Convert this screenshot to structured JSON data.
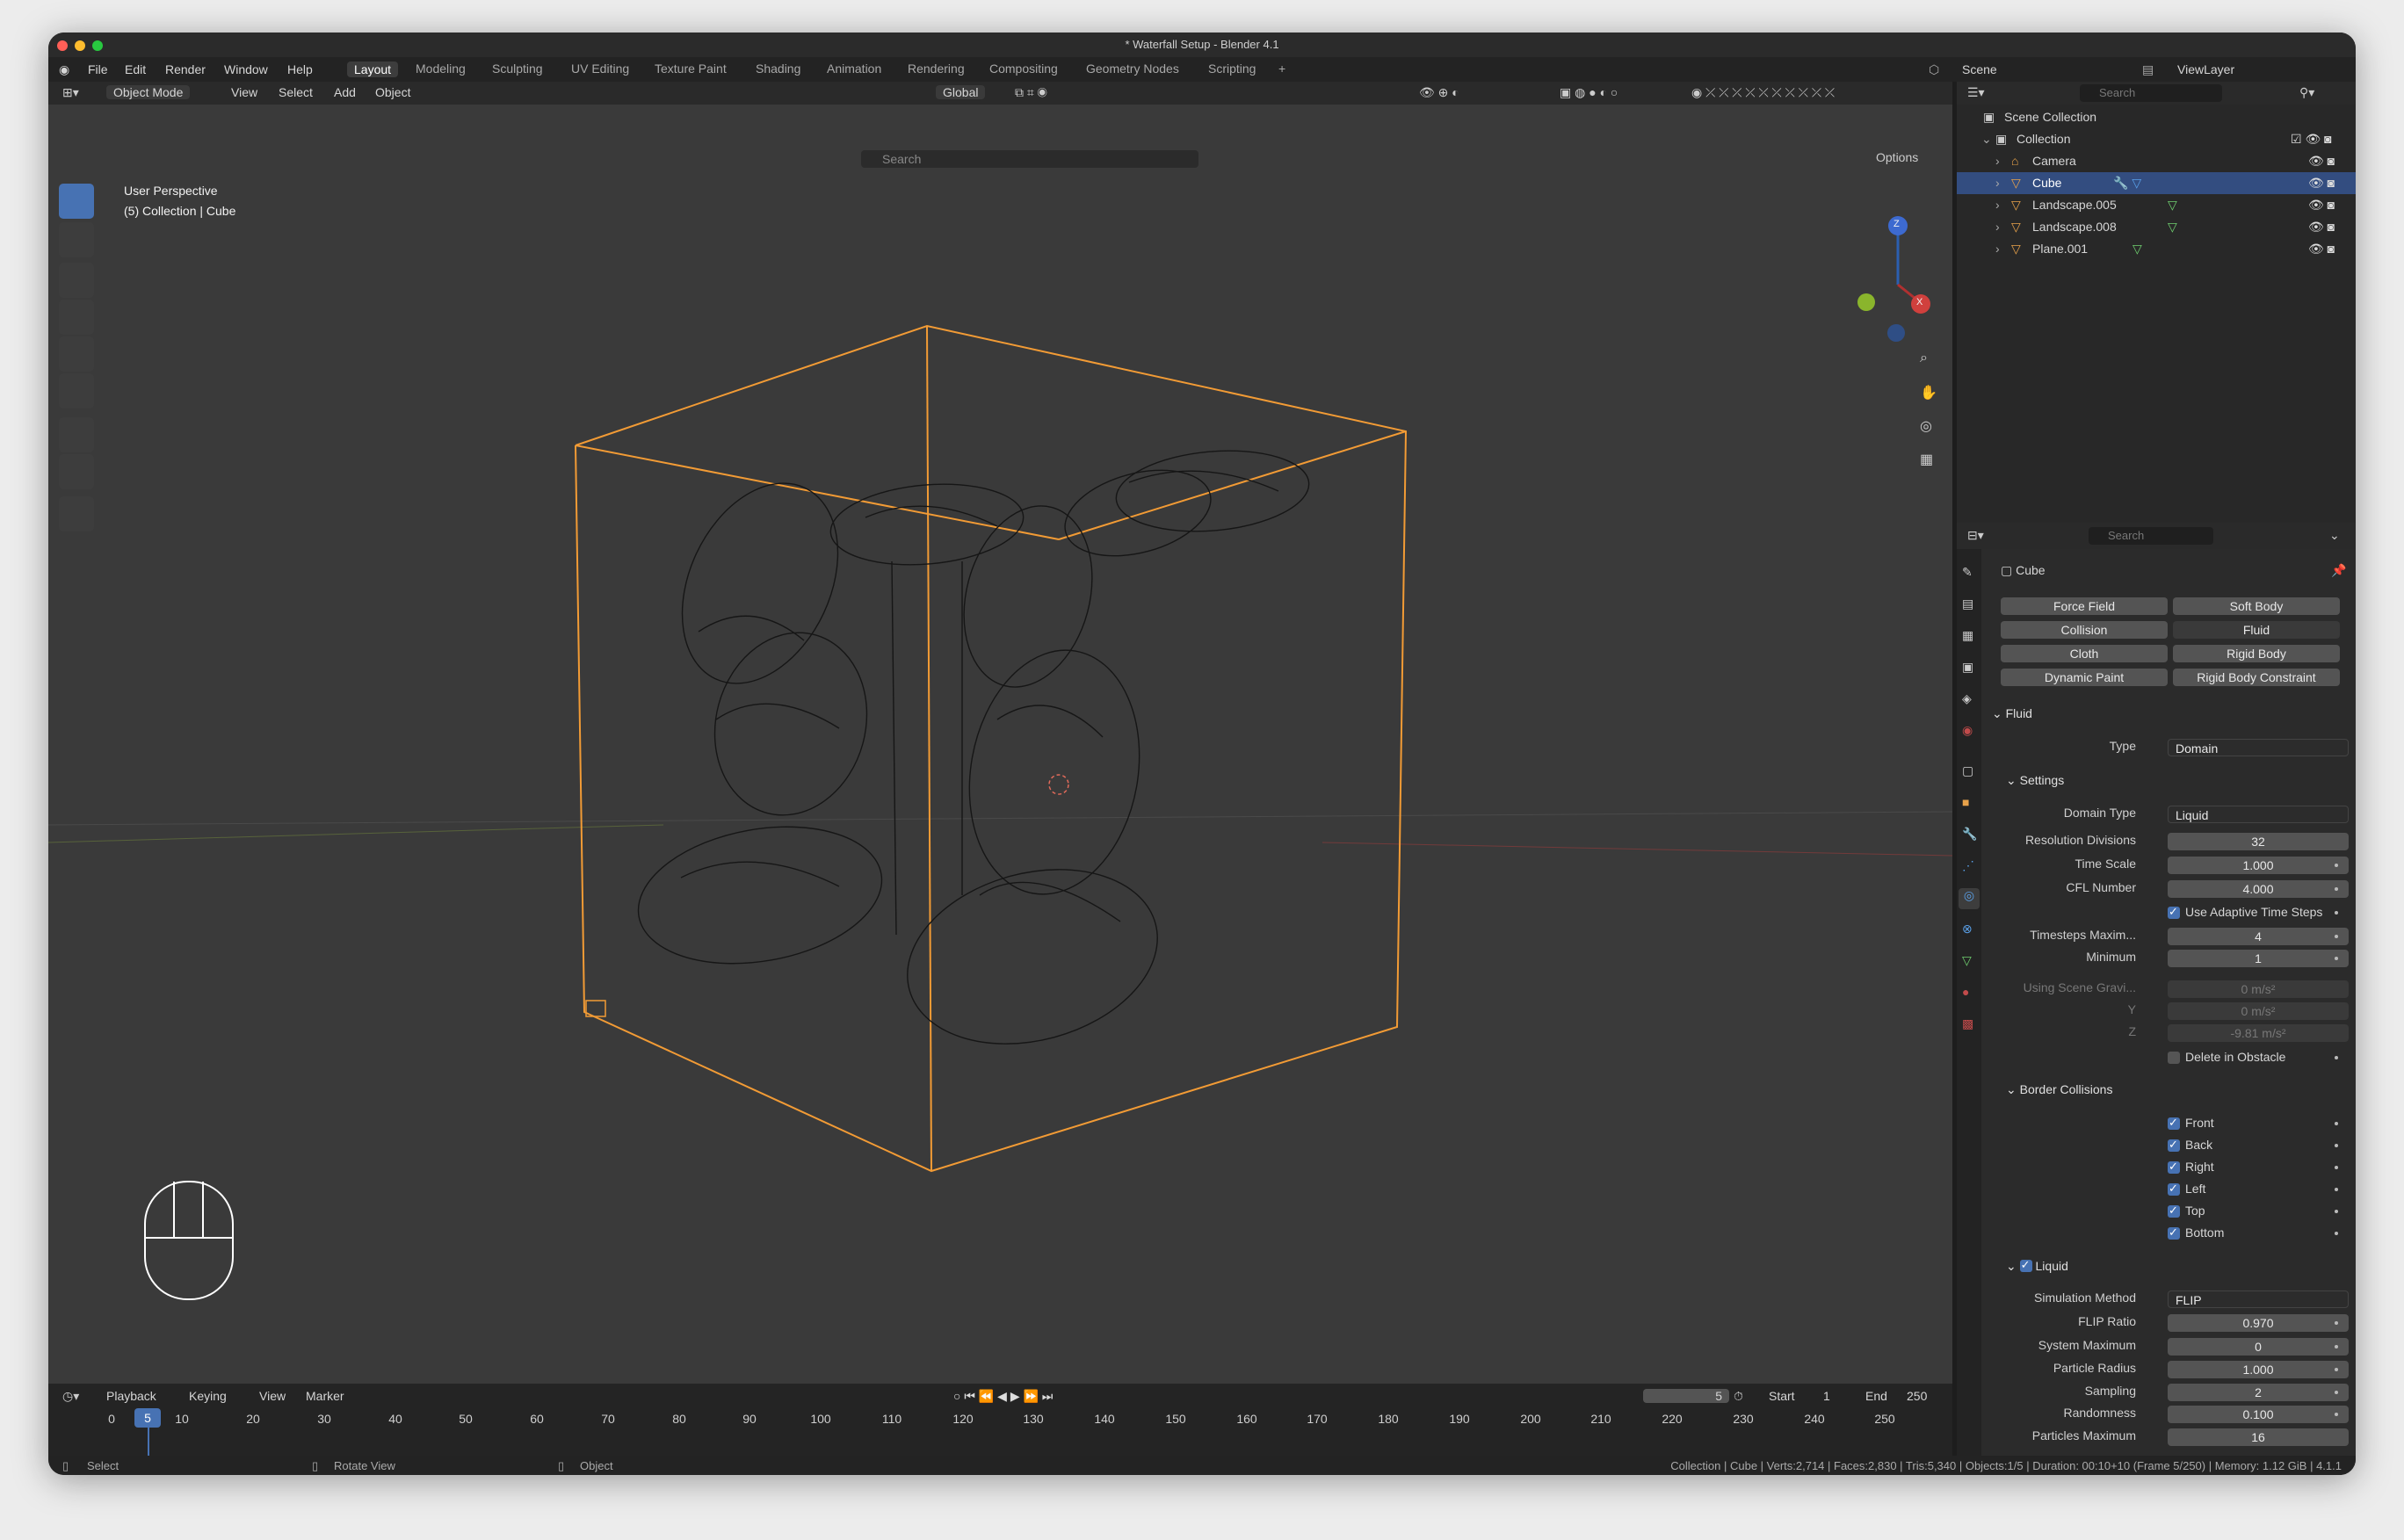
{
  "window_title": "* Waterfall Setup - Blender 4.1",
  "menu": [
    "File",
    "Edit",
    "Render",
    "Window",
    "Help"
  ],
  "workspaces": [
    "Layout",
    "Modeling",
    "Sculpting",
    "UV Editing",
    "Texture Paint",
    "Shading",
    "Animation",
    "Rendering",
    "Compositing",
    "Geometry Nodes",
    "Scripting",
    "+"
  ],
  "active_workspace": "Layout",
  "scene_label": "Scene",
  "viewlayer_label": "ViewLayer",
  "header": {
    "mode": "Object Mode",
    "view": "View",
    "select": "Select",
    "add": "Add",
    "object": "Object",
    "transform": "Global",
    "search_placeholder": "Search",
    "options": "Options"
  },
  "viewport": {
    "perspective": "User Perspective",
    "context": "(5) Collection | Cube"
  },
  "gizmo": {
    "z": "Z",
    "x": "X"
  },
  "outliner": {
    "search_placeholder": "Search",
    "scene_collection": "Scene Collection",
    "collection": "Collection",
    "items": [
      "Camera",
      "Cube",
      "Landscape.005",
      "Landscape.008",
      "Plane.001"
    ]
  },
  "properties": {
    "search_placeholder": "Search",
    "object_name": "Cube",
    "physics_buttons": [
      "Force Field",
      "Soft Body",
      "Collision",
      "Fluid",
      "Cloth",
      "Rigid Body",
      "Dynamic Paint",
      "Rigid Body Constraint"
    ],
    "fluid_section": "Fluid",
    "type_label": "Type",
    "type_value": "Domain",
    "settings_section": "Settings",
    "domain_type_label": "Domain Type",
    "domain_type_value": "Liquid",
    "res_label": "Resolution Divisions",
    "res_value": "32",
    "time_scale_label": "Time Scale",
    "time_scale_value": "1.000",
    "cfl_label": "CFL Number",
    "cfl_value": "4.000",
    "adaptive_label": "Use Adaptive Time Steps",
    "ts_max_label": "Timesteps Maxim...",
    "ts_max_value": "4",
    "ts_min_label": "Minimum",
    "ts_min_value": "1",
    "gravity_label": "Using Scene Gravi...",
    "gravity_x": "0 m/s²",
    "gravity_y_label": "Y",
    "gravity_y": "0 m/s²",
    "gravity_z_label": "Z",
    "gravity_z": "-9.81 m/s²",
    "delete_obstacle_label": "Delete in Obstacle",
    "border_section": "Border Collisions",
    "borders": [
      "Front",
      "Back",
      "Right",
      "Left",
      "Top",
      "Bottom"
    ],
    "liquid_section": "Liquid",
    "sim_method_label": "Simulation Method",
    "sim_method_value": "FLIP",
    "flip_label": "FLIP Ratio",
    "flip_value": "0.970",
    "sysmax_label": "System Maximum",
    "sysmax_value": "0",
    "pradius_label": "Particle Radius",
    "pradius_value": "1.000",
    "sampling_label": "Sampling",
    "sampling_value": "2",
    "random_label": "Randomness",
    "random_value": "0.100",
    "pmax_label": "Particles Maximum",
    "pmax_value": "16"
  },
  "timeline": {
    "playback": "Playback",
    "keying": "Keying",
    "view": "View",
    "marker": "Marker",
    "current_frame": "5",
    "start_label": "Start",
    "start": "1",
    "end_label": "End",
    "end": "250",
    "ticks": [
      "0",
      "10",
      "20",
      "30",
      "40",
      "50",
      "60",
      "70",
      "80",
      "90",
      "100",
      "110",
      "120",
      "130",
      "140",
      "150",
      "160",
      "170",
      "180",
      "190",
      "200",
      "210",
      "220",
      "230",
      "240",
      "250"
    ]
  },
  "statusbar": {
    "select": "Select",
    "rotate": "Rotate View",
    "object": "Object",
    "stats": "Collection | Cube | Verts:2,714 | Faces:2,830 | Tris:5,340 | Objects:1/5 | Duration: 00:10+10 (Frame 5/250) | Memory: 1.12 GiB | 4.1.1"
  },
  "colors": {
    "accent": "#4772b3",
    "selection_orange": "#f29b35",
    "viewport_bg": "#3a3a3a"
  }
}
